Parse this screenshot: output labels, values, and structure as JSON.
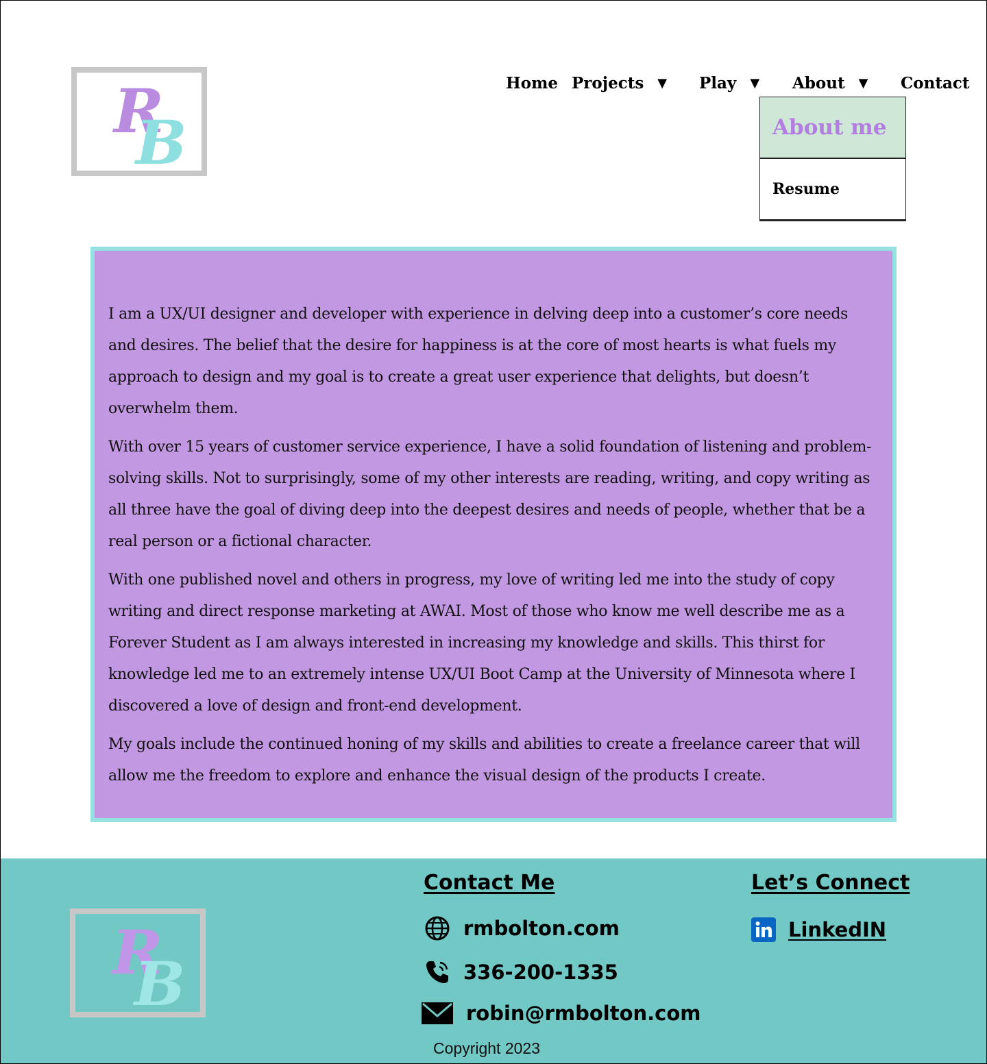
{
  "logo": {
    "letter_r": "R",
    "letter_b": "B"
  },
  "nav": {
    "home": "Home",
    "projects": "Projects",
    "play": "Play",
    "about": "About",
    "contact": "Contact",
    "caret": "▼"
  },
  "about_dropdown": {
    "items": [
      {
        "label": "About me",
        "active": true
      },
      {
        "label": "Resume",
        "active": false
      }
    ]
  },
  "about": {
    "paragraphs": [
      "I am a UX/UI designer and developer with experience in delving deep into a customer’s core needs and desires. The belief that the desire for happiness is at the core of most hearts is what fuels my approach to design and my goal is to create a great user experience that delights, but doesn’t overwhelm them.",
      "With over 15 years of customer service experience, I have a solid foundation of listening and problem-solving skills. Not to surprisingly, some of my other interests are reading, writing, and copy writing as all three have the goal of diving deep into the deepest desires and needs of people, whether that be a real person or a fictional character.",
      "With one published novel and others in progress, my love of writing led me into the study of copy writing and direct response marketing at AWAI. Most of those who know me well describe me as a Forever Student as I am always interested in increasing my knowledge and skills.  This thirst for knowledge led me to an extremely intense UX/UI Boot Camp at the University of Minnesota where I discovered a love of design and front-end development.",
      "My goals include the continued honing of my skills and abilities to create a freelance career that will allow me the freedom to explore and enhance the visual design of the products I create."
    ]
  },
  "footer": {
    "contact_heading": "Contact Me",
    "connect_heading": "Let’s Connect",
    "website": "rmbolton.com",
    "phone": "336-200-1335",
    "email": "robin@rmbolton.com",
    "linkedin": "LinkedIN",
    "copyright": "Copyright 2023"
  },
  "colors": {
    "card_bg": "#c398e2",
    "card_border": "#95e0e0",
    "footer_bg": "#72c8c5",
    "dropdown_active_bg": "#cfe7d6",
    "dropdown_active_text": "#b27fe0",
    "linkedin_blue": "#0a66c2"
  },
  "icons": [
    "globe-icon",
    "phone-icon",
    "mail-icon",
    "linkedin-icon",
    "caret-down-icon"
  ]
}
